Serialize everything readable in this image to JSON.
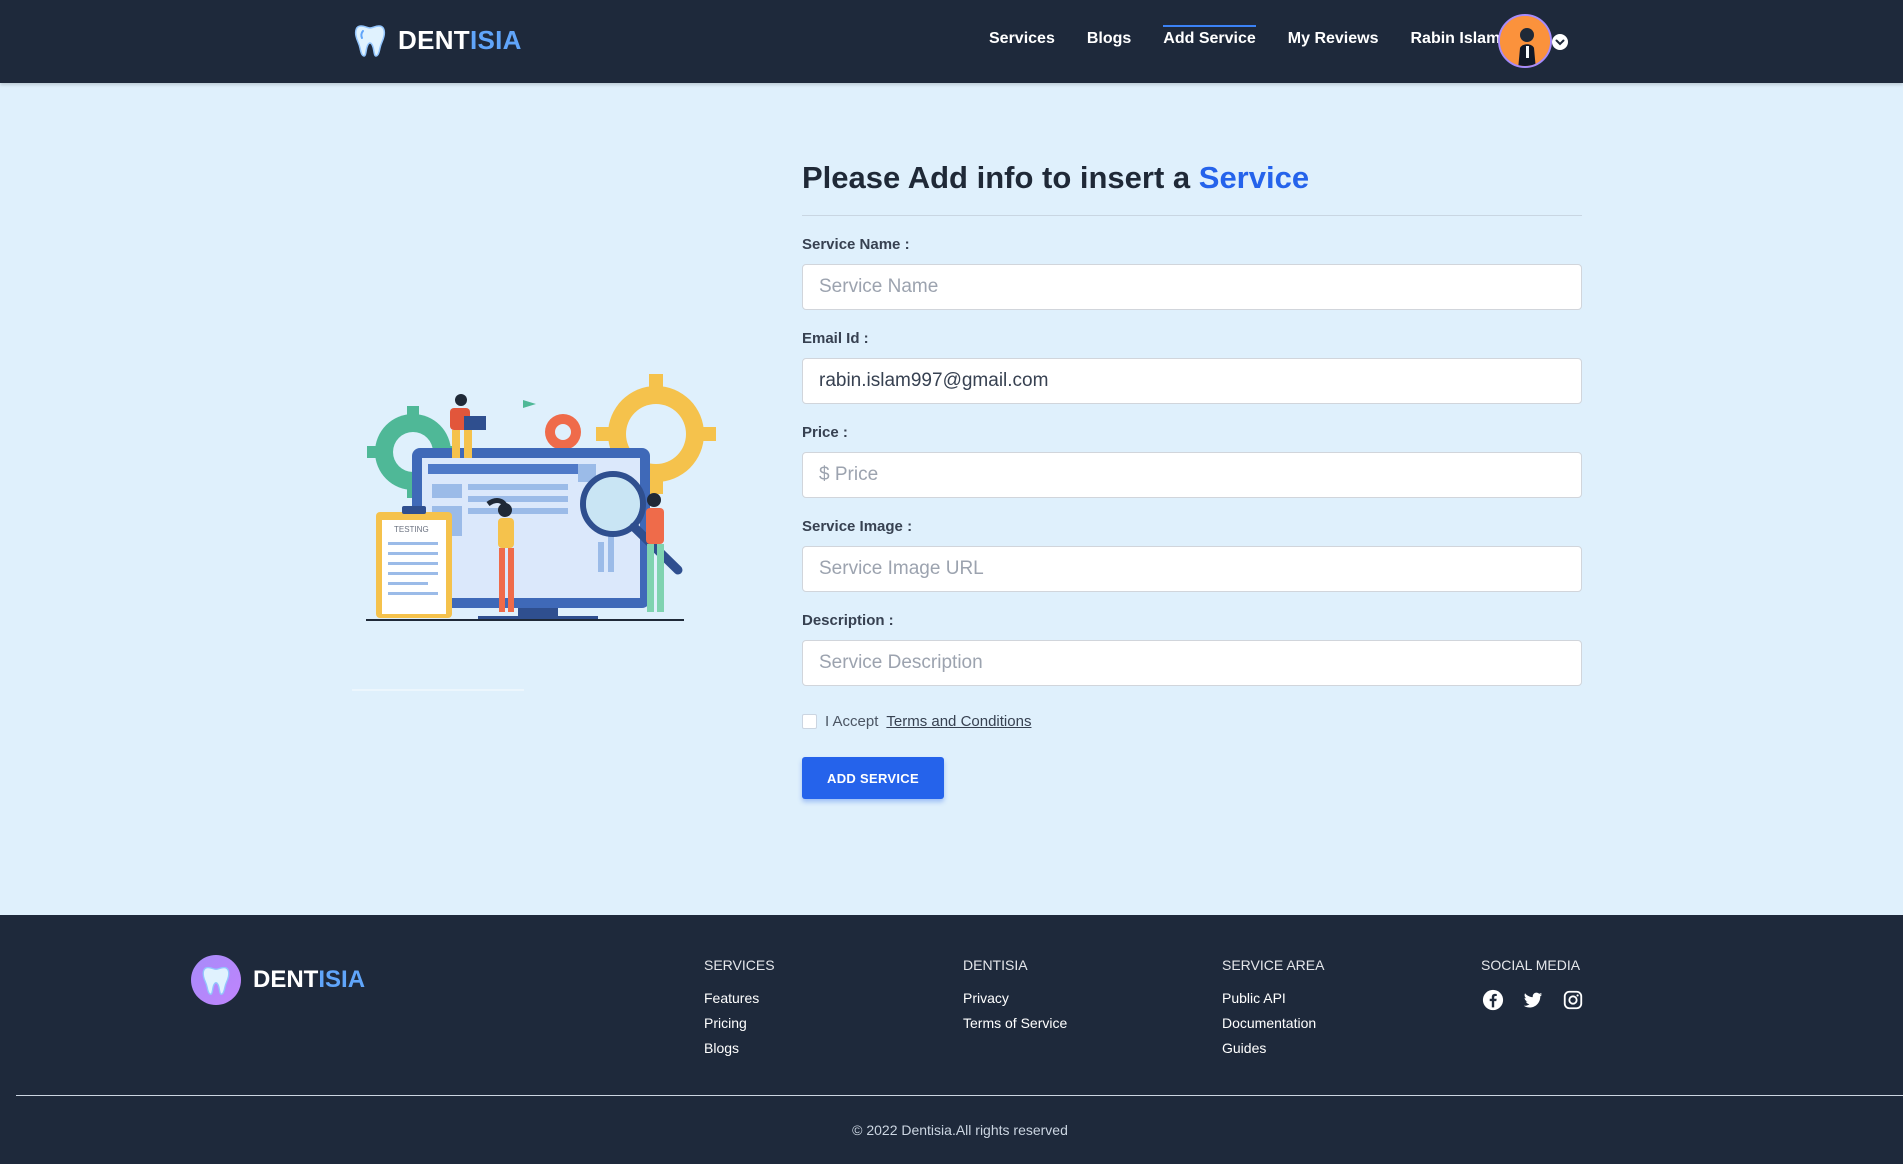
{
  "brand": {
    "part1": "DENT",
    "part2": "ISIA"
  },
  "nav": {
    "items": [
      {
        "label": "Services"
      },
      {
        "label": "Blogs"
      },
      {
        "label": "Add Service"
      },
      {
        "label": "My Reviews"
      },
      {
        "label": "Rabin Islam"
      }
    ],
    "active": "Add Service"
  },
  "form": {
    "title_main": "Please Add info to insert a ",
    "title_highlight": "Service",
    "fields": [
      {
        "label": "Service Name :",
        "placeholder": "Service Name",
        "value": ""
      },
      {
        "label": "Email Id :",
        "placeholder": "",
        "value": "rabin.islam997@gmail.com"
      },
      {
        "label": "Price :",
        "placeholder": "$ Price",
        "value": ""
      },
      {
        "label": "Service Image :",
        "placeholder": "Service Image URL",
        "value": ""
      },
      {
        "label": "Description :",
        "placeholder": "Service Description",
        "value": ""
      }
    ],
    "terms_prefix": "I Accept",
    "terms_link": "Terms and Conditions",
    "terms_checked": false,
    "submit_label": "ADD SERVICE"
  },
  "illustration": {
    "clipboard_label": "TESTING"
  },
  "footer": {
    "brand": {
      "part1": "DENT",
      "part2": "ISIA"
    },
    "columns": [
      {
        "title": "SERVICES",
        "items": [
          "Features",
          "Pricing",
          "Blogs"
        ]
      },
      {
        "title": "DENTISIA",
        "items": [
          "Privacy",
          "Terms of Service"
        ]
      },
      {
        "title": "SERVICE AREA",
        "items": [
          "Public API",
          "Documentation",
          "Guides"
        ]
      }
    ],
    "social": {
      "title": "SOCIAL MEDIA",
      "icons": [
        "facebook-icon",
        "twitter-icon",
        "instagram-icon"
      ]
    },
    "copyright": "© 2022 Dentisia.All rights reserved"
  },
  "colors": {
    "navbar": "#1e293b",
    "accent": "#2563eb",
    "brand_accent": "#60a5fa",
    "page_bg": "#dff0fc"
  }
}
